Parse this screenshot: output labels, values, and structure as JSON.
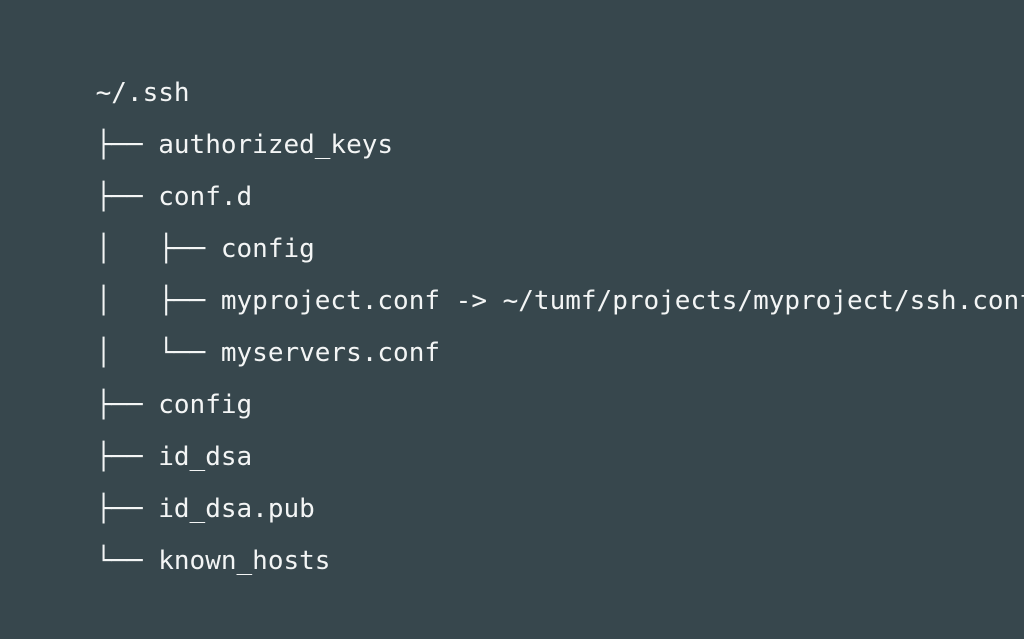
{
  "tree": {
    "lines": [
      {
        "prefix": "",
        "name": "~/.ssh"
      },
      {
        "prefix": "├── ",
        "name": "authorized_keys"
      },
      {
        "prefix": "├── ",
        "name": "conf.d"
      },
      {
        "prefix": "│   ├── ",
        "name": "config"
      },
      {
        "prefix": "│   ├── ",
        "name": "myproject.conf -> ~/tumf/projects/myproject/ssh.conf"
      },
      {
        "prefix": "│   └── ",
        "name": "myservers.conf"
      },
      {
        "prefix": "├── ",
        "name": "config"
      },
      {
        "prefix": "├── ",
        "name": "id_dsa"
      },
      {
        "prefix": "├── ",
        "name": "id_dsa.pub"
      },
      {
        "prefix": "└── ",
        "name": "known_hosts"
      }
    ]
  }
}
